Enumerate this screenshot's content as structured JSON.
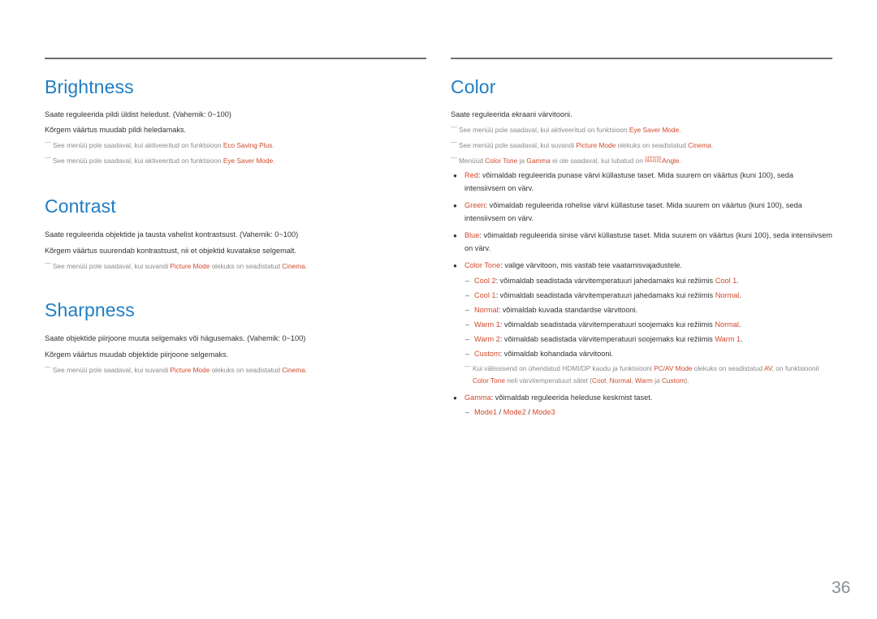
{
  "page_number": "36",
  "colors": {
    "heading": "#1f7dc4",
    "highlight": "#d1492c",
    "body": "#333333",
    "note": "#8a8a8a"
  },
  "brightness": {
    "title": "Brightness",
    "line1": "Saate reguleerida pildi üldist heledust. (Vahemik: 0~100)",
    "line2": "Kõrgem väärtus muudab pildi heledamaks.",
    "note1": {
      "prefix": "See menüü pole saadaval, kui aktiveeritud on funktsioon ",
      "hl": "Eco Saving Plus",
      "suffix": "."
    },
    "note2": {
      "prefix": "See menüü pole saadaval, kui aktiveeritud on funktsioon ",
      "hl": "Eye Saver Mode",
      "suffix": "."
    }
  },
  "contrast": {
    "title": "Contrast",
    "line1": "Saate reguleerida objektide ja tausta vahelist kontrastsust. (Vahemik: 0~100)",
    "line2": "Kõrgem väärtus suurendab kontrastsust, nii et objektid kuvatakse selgemalt.",
    "note1": {
      "prefix": "See menüü pole saadaval, kui suvandi ",
      "hl1": "Picture Mode",
      "mid": " olekuks on seadistatud ",
      "hl2": "Cinema",
      "suffix": "."
    }
  },
  "sharpness": {
    "title": "Sharpness",
    "line1": "Saate objektide piirjoone muuta selgemaks või hägusemaks. (Vahemik: 0~100)",
    "line2": "Kõrgem väärtus muudab objektide piirjoone selgemaks.",
    "note1": {
      "prefix": "See menüü pole saadaval, kui suvandi ",
      "hl1": "Picture Mode",
      "mid": " olekuks on seadistatud ",
      "hl2": "Cinema",
      "suffix": "."
    }
  },
  "color": {
    "title": "Color",
    "intro": "Saate reguleerida ekraani värvitooni.",
    "note1": {
      "prefix": "See menüü pole saadaval, kui aktiveeritud on funktsioon ",
      "hl": "Eye Saver Mode",
      "suffix": "."
    },
    "note2": {
      "prefix": "See menüü pole saadaval, kui suvandi ",
      "hl1": "Picture Mode",
      "mid": " olekuks on seadistatud ",
      "hl2": "Cinema",
      "suffix": "."
    },
    "note3": {
      "prefix": "Menüüd ",
      "hl1": "Color Tone",
      "mid1": " ja ",
      "hl2": "Gamma",
      "mid2": " ei ole saadaval, kui lubatud on ",
      "logo_top": "SAMSUNG",
      "logo_bottom": "MAGIC",
      "hl3": "Angle",
      "suffix": "."
    },
    "bullets": [
      {
        "label": "Red",
        "text": ": võimaldab reguleerida punase värvi küllastuse taset. Mida suurem on väärtus (kuni 100), seda intensiivsem on värv."
      },
      {
        "label": "Green",
        "text": ": võimaldab reguleerida rohelise värvi küllastuse taset. Mida suurem on väärtus (kuni 100), seda intensiivsem on värv."
      },
      {
        "label": "Blue",
        "text": ": võimaldab reguleerida sinise värvi küllastuse taset. Mida suurem on väärtus (kuni 100), seda intensiivsem on värv."
      },
      {
        "label": "Color Tone",
        "text": ": valige värvitoon, mis vastab teie vaatamisvajadustele."
      }
    ],
    "tones": [
      {
        "label": "Cool 2",
        "text": ": võimaldab seadistada värvitemperatuuri jahedamaks kui režiimis ",
        "ref": "Cool 1",
        "end": "."
      },
      {
        "label": "Cool 1",
        "text": ": võimaldab seadistada värvitemperatuuri jahedamaks kui režiimis ",
        "ref": "Normal",
        "end": "."
      },
      {
        "label": "Normal",
        "text": ": võimaldab kuvada standardse värvitooni.",
        "ref": "",
        "end": ""
      },
      {
        "label": "Warm 1",
        "text": ": võimaldab seadistada värvitemperatuuri soojemaks kui režiimis ",
        "ref": "Normal",
        "end": "."
      },
      {
        "label": "Warm 2",
        "text": ": võimaldab seadistada värvitemperatuuri soojemaks kui režiimis ",
        "ref": "Warm 1",
        "end": "."
      },
      {
        "label": "Custom",
        "text": ": võimaldab kohandada värvitooni.",
        "ref": "",
        "end": ""
      }
    ],
    "tone_note": {
      "p1": "Kui välissisend on ühendatud HDMI/DP kaudu ja funktsiooni ",
      "hl1": "PC/AV Mode",
      "p2": " olekuks on seadistatud ",
      "hl2": "AV",
      "p3": ", on funktsioonil ",
      "hl3": "Color Tone",
      "p4": " neli värvitemperatuuri sätet (",
      "hl4": "Cool",
      "p5": ", ",
      "hl5": "Normal",
      "p6": ", ",
      "hl6": "Warm",
      "p7": " ja ",
      "hl7": "Custom",
      "p8": ")."
    },
    "gamma": {
      "label": "Gamma",
      "text": ": võimaldab reguleerida heleduse keskmist taset."
    },
    "gamma_modes": {
      "m1": "Mode1",
      "sep": " / ",
      "m2": "Mode2",
      "m3": "Mode3"
    }
  }
}
